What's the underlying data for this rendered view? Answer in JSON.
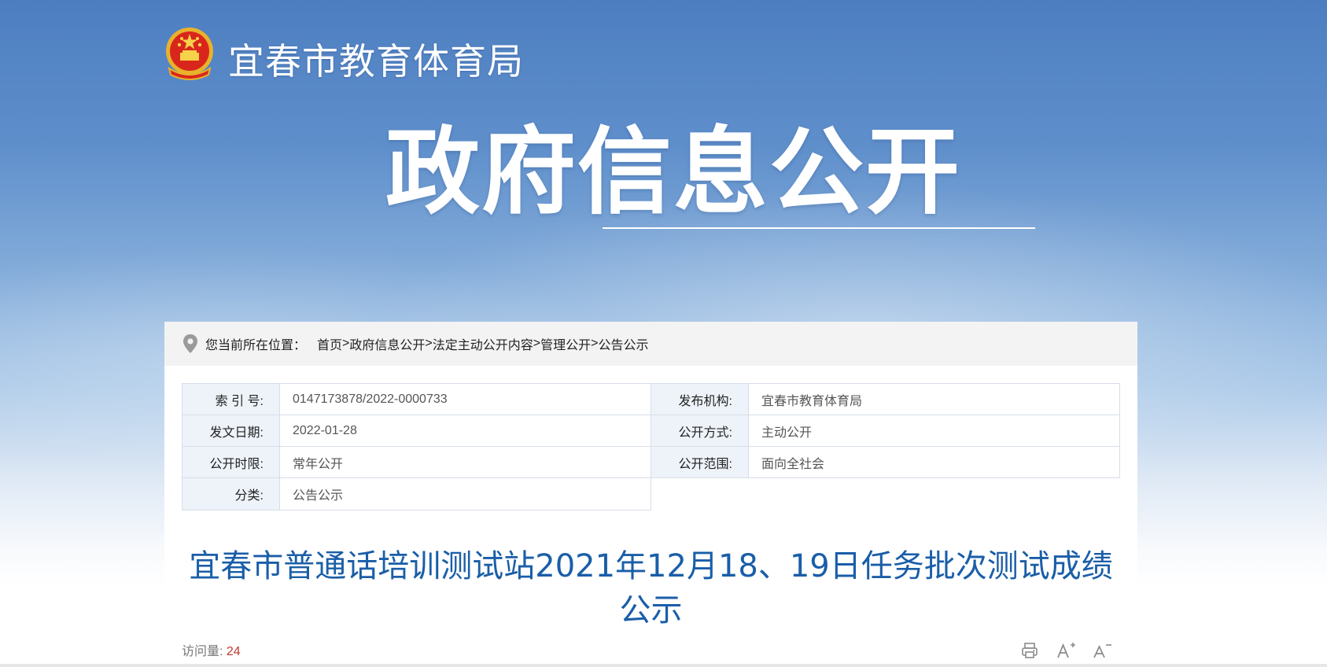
{
  "header": {
    "site_title": "宜春市教育体育局",
    "banner_title": "政府信息公开",
    "emblem_icon": "national-emblem-icon"
  },
  "breadcrumb": {
    "prefix": "您当前所在位置：",
    "items": [
      "首页",
      "政府信息公开",
      "法定主动公开内容",
      "管理公开",
      "公告公示"
    ],
    "separator": ">"
  },
  "meta": {
    "rows": [
      {
        "l1": "索 引 号:",
        "v1": "0147173878/2022-0000733",
        "l2": "发布机构:",
        "v2": "宜春市教育体育局"
      },
      {
        "l1": "发文日期:",
        "v1": "2022-01-28",
        "l2": "公开方式:",
        "v2": "主动公开"
      },
      {
        "l1": "公开时限:",
        "v1": "常年公开",
        "l2": "公开范围:",
        "v2": "面向全社会"
      },
      {
        "l1": "分类:",
        "v1": "公告公示"
      }
    ]
  },
  "article": {
    "title_line1": "宜春市普通话培训测试站2021年12月18、19日任务批次测试成绩",
    "title_line2": "公示"
  },
  "stats": {
    "views_label": "访问量:",
    "views_count": "24"
  },
  "tools": {
    "print_icon": "printer-icon",
    "font_increase_icon": "font-increase-icon",
    "font_decrease_icon": "font-decrease-icon"
  },
  "colors": {
    "title_blue": "#1a5ea8",
    "label_bg": "#eef3fa",
    "count_red": "#c0392b"
  }
}
